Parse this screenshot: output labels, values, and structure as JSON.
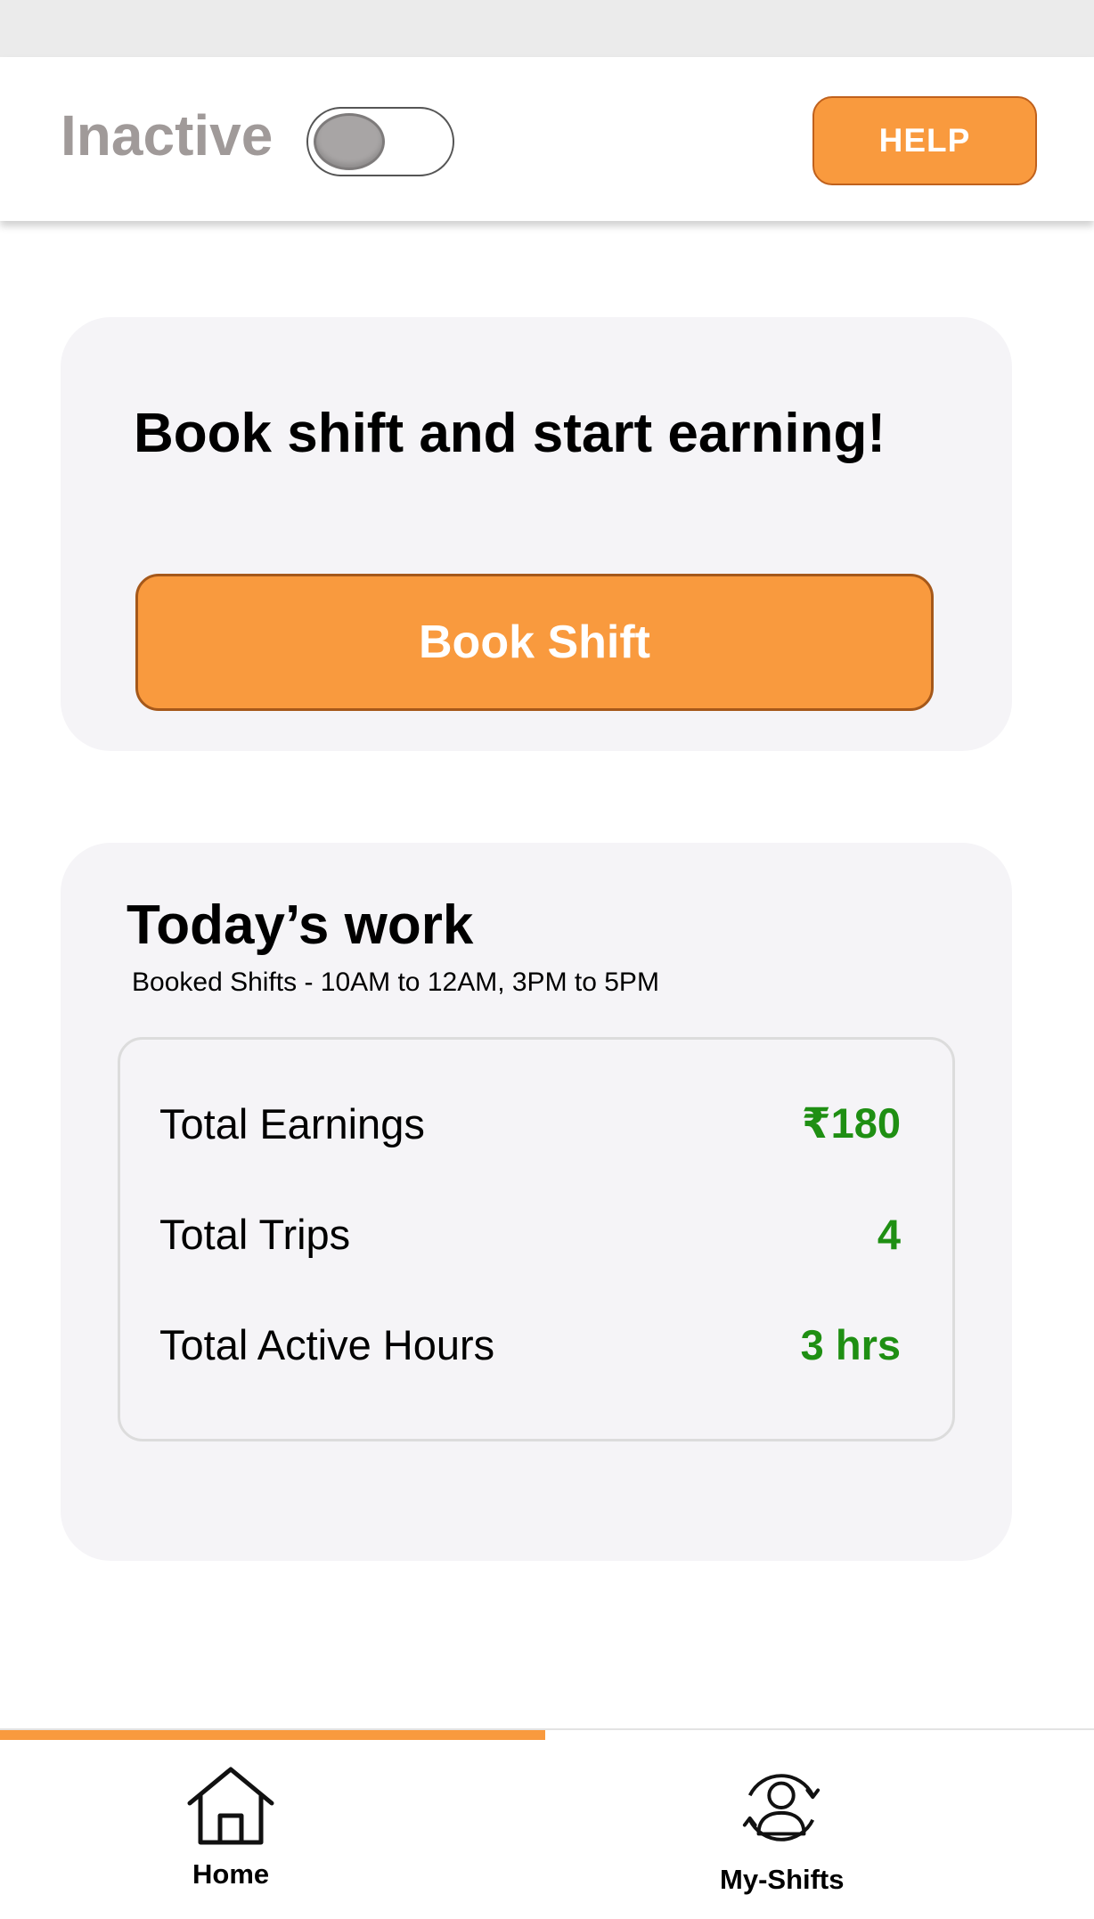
{
  "header": {
    "status_label": "Inactive",
    "toggle_on": false,
    "help_label": "HELP"
  },
  "book_card": {
    "title": "Book shift and start earning!",
    "button_label": "Book Shift"
  },
  "work_card": {
    "title": "Today’s work",
    "subtitle": "Booked Shifts - 10AM to 12AM, 3PM to 5PM",
    "stats": [
      {
        "label": "Total Earnings",
        "value": "₹180"
      },
      {
        "label": "Total Trips",
        "value": "4"
      },
      {
        "label": "Total Active Hours",
        "value": "3 hrs"
      }
    ]
  },
  "bottom_nav": {
    "tabs": [
      {
        "label": "Home",
        "icon": "home-icon",
        "active": true
      },
      {
        "label": "My-Shifts",
        "icon": "user-cycle-icon",
        "active": false
      }
    ]
  },
  "colors": {
    "accent": "#f99a3e",
    "positive": "#1f8f13",
    "inactive_text": "#a09a99",
    "card_bg": "#f5f4f7"
  }
}
